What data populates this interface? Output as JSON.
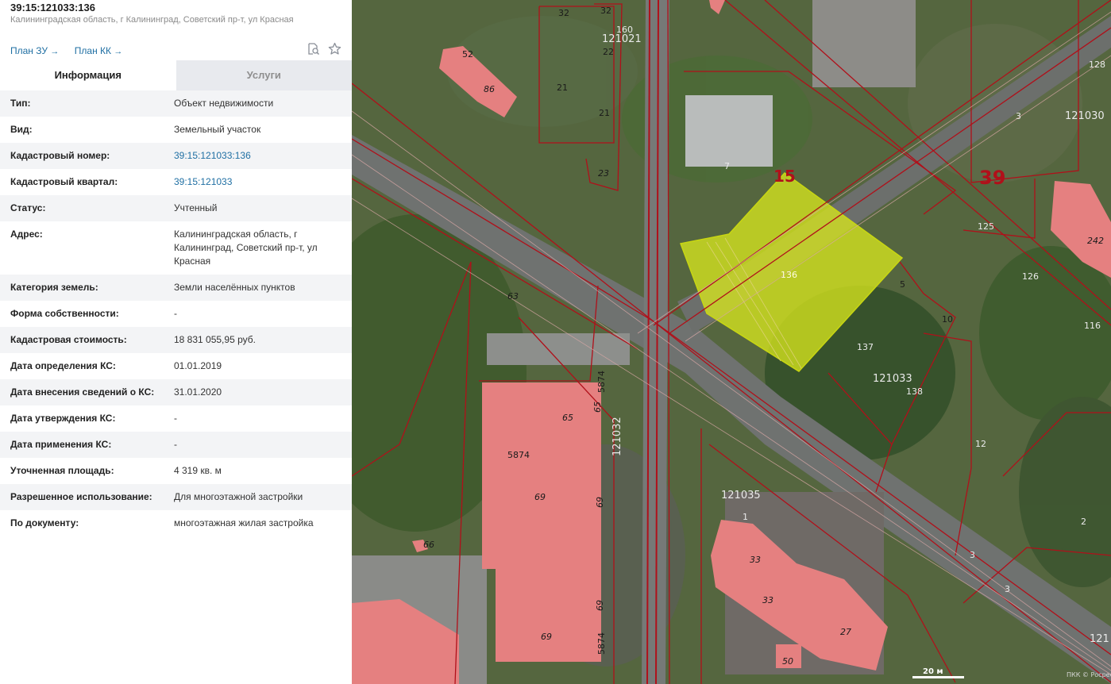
{
  "header": {
    "cadastral_number": "39:15:121033:136",
    "address": "Калининградская область, г Калининград, Советский пр-т, ул Красная"
  },
  "links": {
    "plan_zu": "План ЗУ",
    "plan_kk": "План КК",
    "arrow": "→"
  },
  "icons": {
    "search": "search-document-icon",
    "favorite": "star-icon"
  },
  "tabs": [
    {
      "label": "Информация",
      "active": true
    },
    {
      "label": "Услуги",
      "active": false
    }
  ],
  "info_rows": [
    {
      "key": "Тип:",
      "value": "Объект недвижимости"
    },
    {
      "key": "Вид:",
      "value": "Земельный участок"
    },
    {
      "key": "Кадастровый номер:",
      "value": "39:15:121033:136"
    },
    {
      "key": "Кадастровый квартал:",
      "value": "39:15:121033"
    },
    {
      "key": "Статус:",
      "value": "Учтенный"
    },
    {
      "key": "Адрес:",
      "value": "Калининградская область, г Калининград, Советский пр-т, ул Красная"
    },
    {
      "key": "Категория земель:",
      "value": "Земли населённых пунктов"
    },
    {
      "key": "Форма собственности:",
      "value": "-"
    },
    {
      "key": "Кадастровая стоимость:",
      "value": "18 831 055,95 руб."
    },
    {
      "key": "Дата определения КС:",
      "value": "01.01.2019"
    },
    {
      "key": "Дата внесения сведений о КС:",
      "value": "31.01.2020"
    },
    {
      "key": "Дата утверждения КС:",
      "value": "-"
    },
    {
      "key": "Дата применения КС:",
      "value": "-"
    },
    {
      "key": "Уточненная площадь:",
      "value": "4 319 кв. м"
    },
    {
      "key": "Разрешенное использование:",
      "value": "Для многоэтажной застройки"
    },
    {
      "key": "По документу:",
      "value": "многоэтажная жилая застройка"
    }
  ],
  "map": {
    "labels": {
      "l32a": "32",
      "l32b": "32",
      "l160": "160",
      "q121021": "121021",
      "l22": "22",
      "l52": "52",
      "l86": "86",
      "l21a": "21",
      "l21b": "21",
      "l23": "23",
      "l7": "7",
      "l15": "15",
      "l136": "136",
      "l5": "5",
      "l10": "10",
      "l137": "137",
      "q121033": "121033",
      "l138": "138",
      "l63": "63",
      "l5874a": "5874",
      "l65a": "65",
      "l65b": "65",
      "l5874b": "5874",
      "q121032": "121032",
      "l69a": "69",
      "l69b": "69",
      "l69c": "69",
      "l69d": "69",
      "l5874c": "5874",
      "l66": "66",
      "q121035": "121035",
      "l1": "1",
      "l33a": "33",
      "l33b": "33",
      "l27": "27",
      "l50": "50",
      "l3a": "3",
      "q121030": "121030",
      "l39": "39",
      "l125": "125",
      "l128": "128",
      "l242": "242",
      "l126": "126",
      "l116": "116",
      "l12": "12",
      "l2": "2",
      "l3b": "3",
      "l3c": "3",
      "l121": "121"
    },
    "scale": "20 м",
    "copyright": "ПКК © Росреестр"
  },
  "colors": {
    "link": "#1f6fa3",
    "parcel_border": "#b0101a",
    "building_fill": "#e58080",
    "selected_fill": "#d6e61e",
    "tab_inactive_bg": "#e8eaee"
  }
}
